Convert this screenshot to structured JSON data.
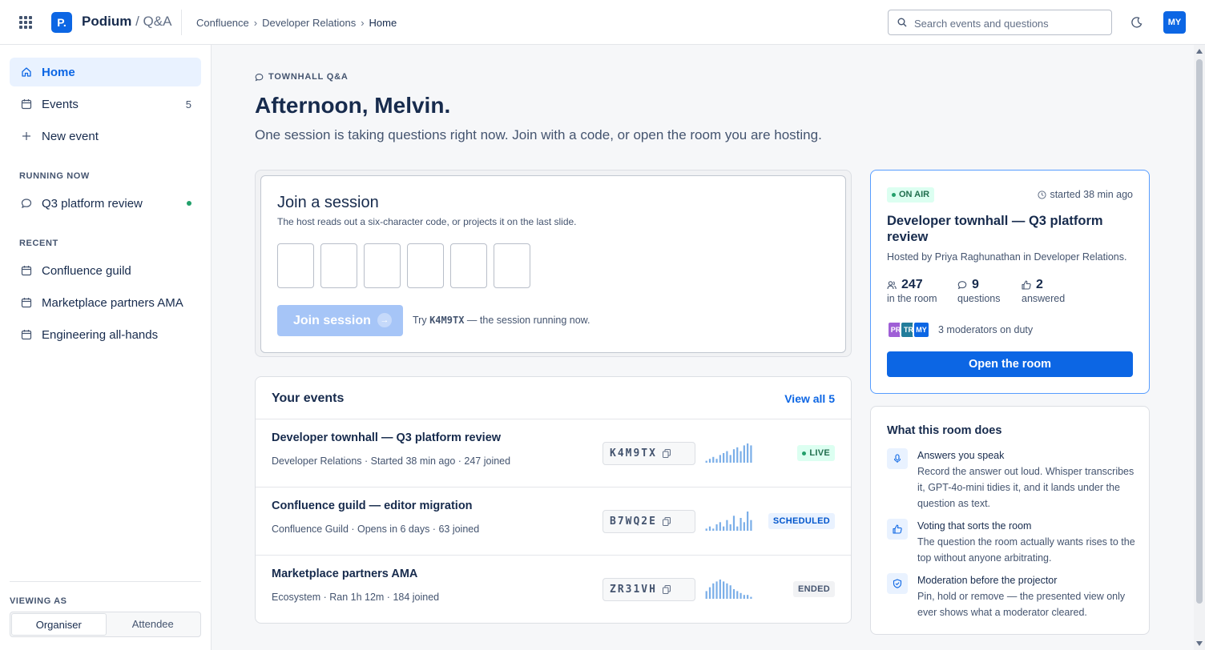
{
  "header": {
    "logo_letter": "P.",
    "brand": "Podium",
    "brand_suffix": " / Q&A",
    "breadcrumbs": [
      "Confluence",
      "Developer Relations",
      "Home"
    ],
    "search_placeholder": "Search events and questions",
    "avatar": "MY"
  },
  "sidebar": {
    "nav": [
      {
        "label": "Home",
        "icon": "home-icon",
        "active": true
      },
      {
        "label": "Events",
        "icon": "calendar-icon",
        "count": "5"
      },
      {
        "label": "New event",
        "icon": "plus-icon"
      }
    ],
    "running_now_heading": "RUNNING NOW",
    "running": [
      {
        "label": "Q3 platform review",
        "icon": "chat-icon"
      }
    ],
    "recent_heading": "RECENT",
    "recent": [
      {
        "label": "Confluence guild",
        "icon": "calendar-icon"
      },
      {
        "label": "Marketplace partners AMA",
        "icon": "calendar-icon"
      },
      {
        "label": "Engineering all-hands",
        "icon": "calendar-icon"
      }
    ],
    "viewing_as_heading": "VIEWING AS",
    "roles": [
      "Organiser",
      "Attendee"
    ],
    "selected_role": "Organiser"
  },
  "main": {
    "eyebrow": "TOWNHALL Q&A",
    "greeting": "Afternoon, Melvin.",
    "lead": "One session is taking questions right now. Join with a code, or open the room you are hosting."
  },
  "join": {
    "title": "Join a session",
    "hint": "The host reads out a six-character code, or projects it on the last slide.",
    "code_length": 6,
    "button": "Join session",
    "try_prefix": "Try",
    "try_code": "K4M9TX",
    "try_suffix": "— the session running now."
  },
  "events": {
    "heading": "Your events",
    "view_all": "View all 5",
    "rows": [
      {
        "title": "Developer townhall — Q3 platform review",
        "sub": "Developer Relations · Started 38 min ago · 247 joined",
        "code": "K4M9TX",
        "status": "LIVE",
        "activity": [
          1,
          2,
          3,
          2,
          4,
          5,
          6,
          4,
          7,
          8,
          6,
          9,
          10,
          9
        ]
      },
      {
        "title": "Confluence guild — editor migration",
        "sub": "Confluence Guild · Opens in 6 days · 63 joined",
        "code": "B7WQ2E",
        "status": "SCHEDULED",
        "activity": [
          1,
          2,
          1,
          3,
          4,
          2,
          5,
          3,
          7,
          2,
          6,
          4,
          9,
          5
        ]
      },
      {
        "title": "Marketplace partners AMA",
        "sub": "Ecosystem · Ran 1h 12m · 184 joined",
        "code": "ZR31VH",
        "status": "ENDED",
        "activity": [
          4,
          6,
          8,
          9,
          10,
          9,
          8,
          7,
          5,
          4,
          3,
          2,
          2,
          1
        ]
      }
    ]
  },
  "on_air": {
    "badge": "ON AIR",
    "started": "started 38 min ago",
    "title": "Developer townhall — Q3 platform review",
    "host": "Hosted by Priya Raghunathan in Developer Relations.",
    "stats": [
      {
        "value": "247",
        "label": "in the room",
        "icon": "people-icon"
      },
      {
        "value": "9",
        "label": "questions",
        "icon": "chat-icon"
      },
      {
        "value": "2",
        "label": "answered",
        "icon": "thumbs-up-icon"
      }
    ],
    "moderators": [
      {
        "initials": "PR",
        "color": "#9f5fd6"
      },
      {
        "initials": "TR",
        "color": "#227d9b"
      },
      {
        "initials": "MY",
        "color": "#0c66e4"
      }
    ],
    "moderators_text": "3 moderators on duty",
    "button": "Open the room"
  },
  "room_does": {
    "heading": "What this room does",
    "features": [
      {
        "title": "Answers you speak",
        "desc": "Record the answer out loud. Whisper transcribes it, GPT-4o-mini tidies it, and it lands under the question as text.",
        "icon": "mic-icon"
      },
      {
        "title": "Voting that sorts the room",
        "desc": "The question the room actually wants rises to the top without anyone arbitrating.",
        "icon": "thumbs-up-icon"
      },
      {
        "title": "Moderation before the projector",
        "desc": "Pin, hold or remove — the presented view only ever shows what a moderator cleared.",
        "icon": "shield-icon"
      }
    ]
  },
  "colors": {
    "accent": "#0c66e4",
    "live": "#22a06b",
    "spark": "#7aaee8"
  }
}
